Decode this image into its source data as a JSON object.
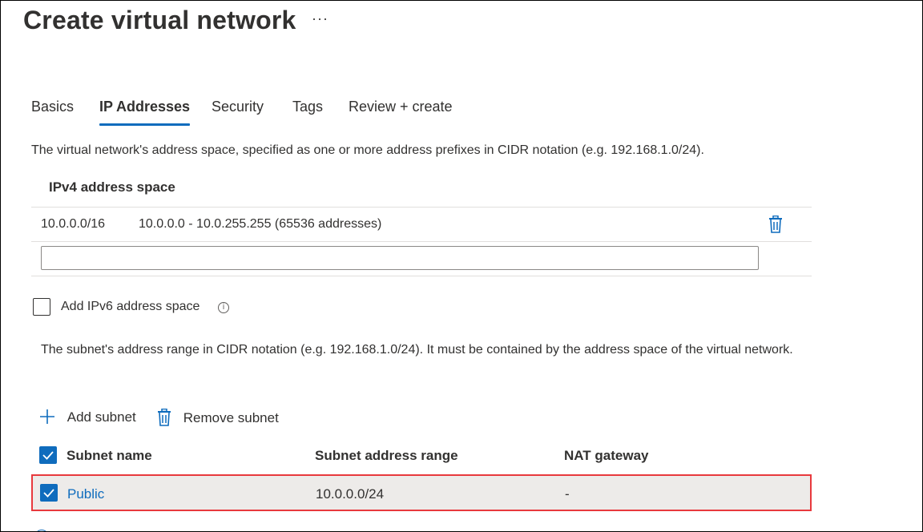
{
  "page": {
    "title": "Create virtual network",
    "more_label": "···"
  },
  "tabs": [
    {
      "label": "Basics",
      "active": false
    },
    {
      "label": "IP Addresses",
      "active": true
    },
    {
      "label": "Security",
      "active": false
    },
    {
      "label": "Tags",
      "active": false
    },
    {
      "label": "Review + create",
      "active": false
    }
  ],
  "address_space": {
    "description": "The virtual network's address space, specified as one or more address prefixes in CIDR notation (e.g. 192.168.1.0/24).",
    "header": "IPv4 address space",
    "entries": [
      {
        "prefix": "10.0.0.0/16",
        "range": "10.0.0.0 - 10.0.255.255 (65536 addresses)"
      }
    ],
    "new_entry_value": "",
    "ipv6_checkbox_label": "Add IPv6 address space",
    "ipv6_checked": false
  },
  "subnets": {
    "description": "The subnet's address range in CIDR notation (e.g. 192.168.1.0/24). It must be contained by the address space of the virtual network.",
    "add_label": "Add subnet",
    "remove_label": "Remove subnet",
    "columns": [
      "Subnet name",
      "Subnet address range",
      "NAT gateway"
    ],
    "rows": [
      {
        "name": "Public",
        "range": "10.0.0.0/24",
        "nat": "-",
        "selected": true
      }
    ]
  },
  "colors": {
    "accent": "#0f6cbd",
    "highlight_border": "#e8393d",
    "selected_row": "#edebe9"
  },
  "icons": {
    "more": "more-icon",
    "delete": "trash-icon",
    "info": "info-icon",
    "add": "plus-icon",
    "check": "checkmark-icon"
  }
}
